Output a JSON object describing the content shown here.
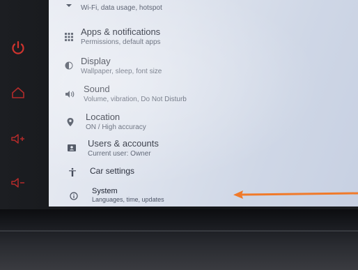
{
  "hardware_buttons": [
    {
      "icon": "power-icon",
      "color": "#c7322d"
    },
    {
      "icon": "home-icon",
      "color": "#b52a2a"
    },
    {
      "icon": "volume-up-icon",
      "color": "#b52a2a"
    },
    {
      "icon": "volume-down-icon",
      "color": "#b52a2a"
    }
  ],
  "settings": {
    "items": [
      {
        "title": "",
        "subtitle": "Wi-Fi, data usage, hotspot",
        "icon": "chevron-down-icon"
      },
      {
        "title": "Apps & notifications",
        "subtitle": "Permissions, default apps",
        "icon": "apps-grid-icon"
      },
      {
        "title": "Display",
        "subtitle": "Wallpaper, sleep, font size",
        "icon": "brightness-icon"
      },
      {
        "title": "Sound",
        "subtitle": "Volume, vibration, Do Not Disturb",
        "icon": "speaker-icon"
      },
      {
        "title": "Location",
        "subtitle": "ON / High accuracy",
        "icon": "location-pin-icon"
      },
      {
        "title": "Users & accounts",
        "subtitle": "Current user: Owner",
        "icon": "account-card-icon"
      },
      {
        "title": "Car settings",
        "subtitle": "",
        "icon": "car-settings-icon"
      },
      {
        "title": "System",
        "subtitle": "Languages, time, updates",
        "icon": "info-icon"
      }
    ]
  },
  "annotation": {
    "type": "arrow",
    "color": "#f07a2a",
    "points_to": "System"
  }
}
